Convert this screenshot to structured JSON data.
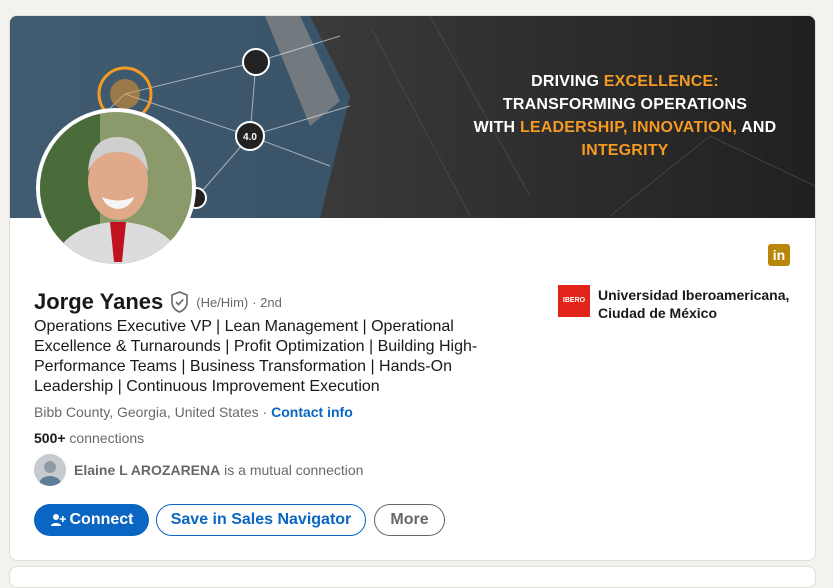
{
  "banner": {
    "line1_a": "DRIVING ",
    "line1_b": "EXCELLENCE:",
    "line2": "TRANSFORMING OPERATIONS",
    "line3_a": "WITH ",
    "line3_b": "LEADERSHIP, INNOVATION,",
    "line3_c": " AND",
    "line4": "INTEGRITY",
    "badge_text": "4.0"
  },
  "profile": {
    "name": "Jorge Yanes",
    "pronouns": "(He/Him)",
    "degree": "· 2nd",
    "headline": "Operations Executive VP | Lean Management | Operational Excellence & Turnarounds | Profit Optimization | Building High-Performance Teams | Business Transformation | Hands-On Leadership | Continuous Improvement Execution",
    "location": "Bibb County, Georgia, United States",
    "location_sep": " · ",
    "contact_info": "Contact info",
    "connections_count": "500+",
    "connections_label": " connections",
    "mutual_name": "Elaine L AROZARENA",
    "mutual_suffix": " is a mutual connection"
  },
  "actions": {
    "connect": "Connect",
    "save_nav": "Save in Sales Navigator",
    "more": "More"
  },
  "education": {
    "logo_text": "IBERO",
    "name": "Universidad Iberoamericana, Ciudad de México"
  },
  "linkedin_badge": "in",
  "colors": {
    "brand_blue": "#0a66c2",
    "banner_accent": "#f59a23",
    "linkedin_badge": "#b8860b",
    "ibero_red": "#e2231a"
  }
}
